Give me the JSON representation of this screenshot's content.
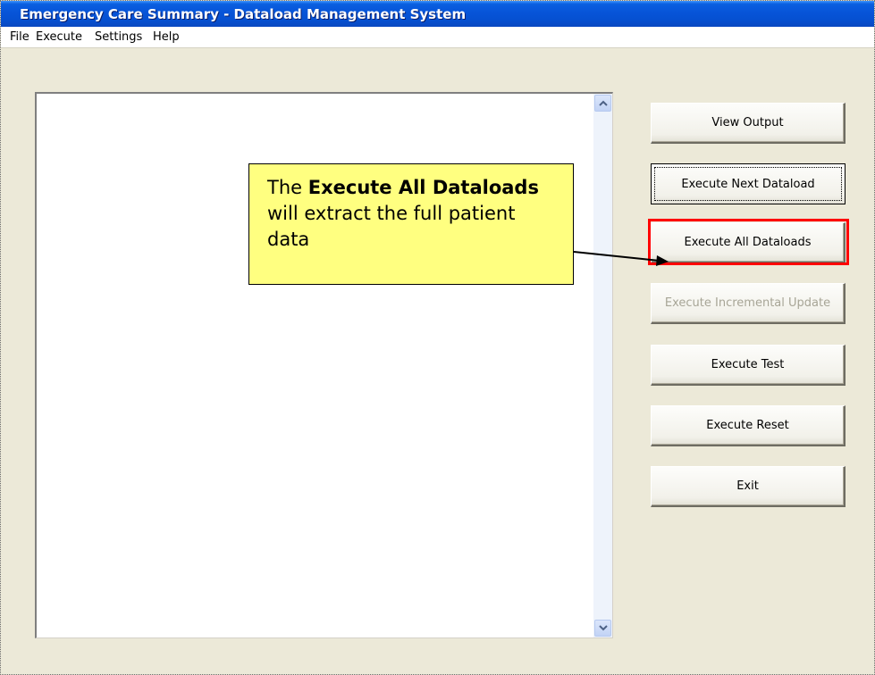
{
  "window": {
    "title": "Emergency Care Summary - Dataload Management System"
  },
  "menu": {
    "items": [
      "File",
      "Execute",
      "Settings",
      "Help"
    ]
  },
  "buttons": {
    "view_output": "View Output",
    "execute_next": "Execute Next Dataload",
    "execute_all": "Execute All Dataloads",
    "execute_incremental": "Execute Incremental Update",
    "execute_test": "Execute Test",
    "execute_reset": "Execute Reset",
    "exit": "Exit"
  },
  "callout": {
    "prefix": "The ",
    "bold": "Execute All Dataloads",
    "suffix": " will extract the full patient data"
  },
  "colors": {
    "highlight": "#ff0000",
    "callout_bg": "#ffff80",
    "titlebar": "#0754d8"
  }
}
